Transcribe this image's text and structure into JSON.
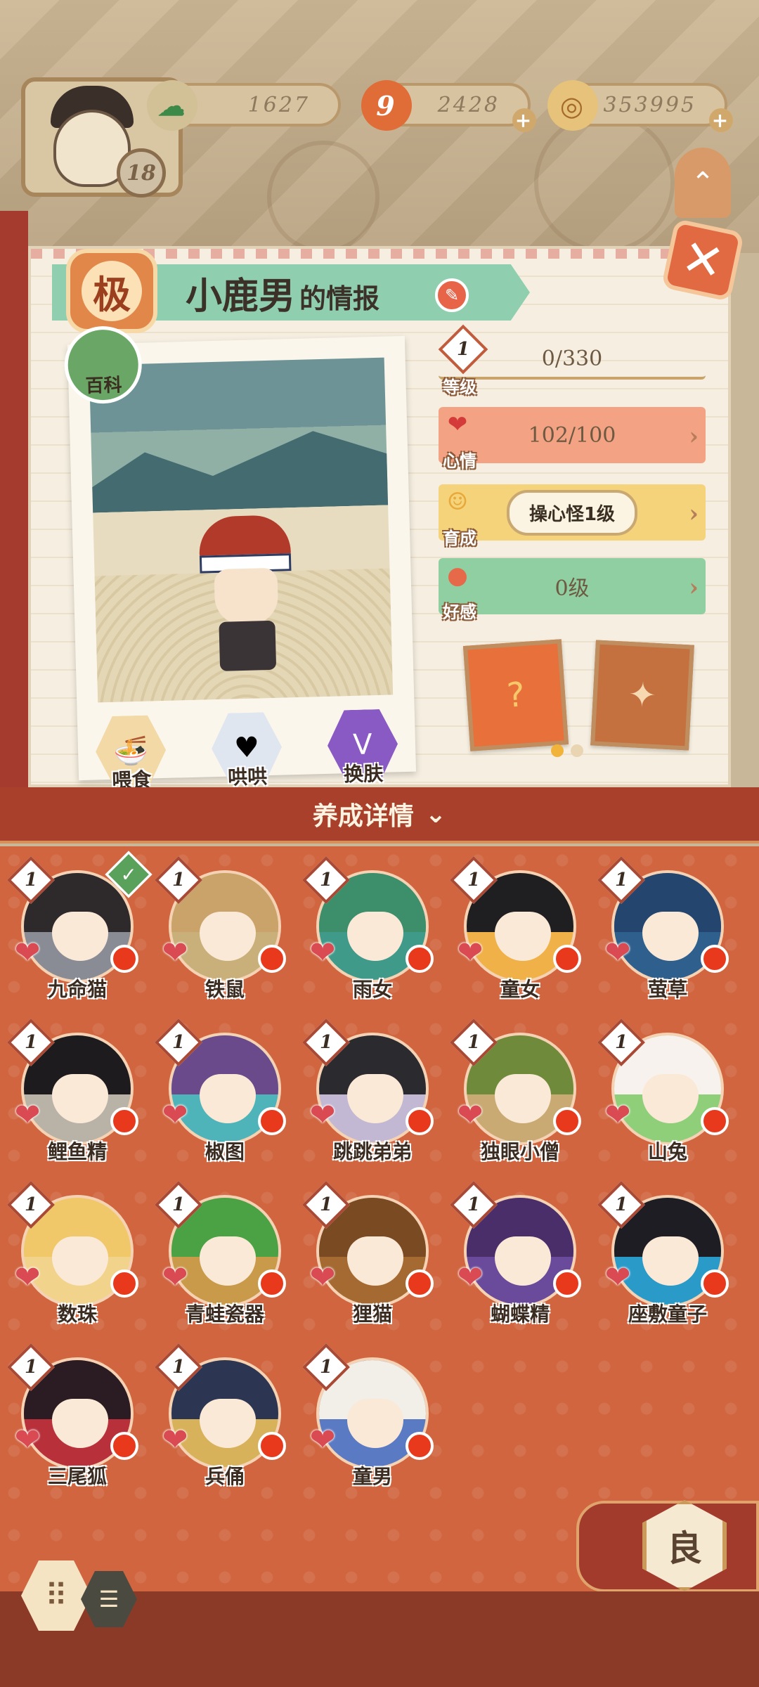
{
  "header": {
    "player_level": "18",
    "currencies": [
      {
        "name": "jade",
        "value": "1627",
        "icon": "pine-cloud-icon",
        "color": "#3d8a48"
      },
      {
        "name": "scroll",
        "value": "2428",
        "icon": "scroll-icon",
        "color": "#e06c38"
      },
      {
        "name": "coin",
        "value": "353995",
        "icon": "coin-icon",
        "color": "#d39a3a"
      }
    ]
  },
  "info": {
    "rank": "极",
    "character_name": "小鹿男",
    "title_suffix": "的情报",
    "baike_label": "百科"
  },
  "actions": [
    {
      "key": "feed",
      "label": "喂食",
      "icon": "noodle-bowl-icon",
      "color": "#f2d9a6"
    },
    {
      "key": "coax",
      "label": "哄哄",
      "icon": "milk-carton-icon",
      "color": "#dfe6f0"
    },
    {
      "key": "skin",
      "label": "换肤",
      "icon": "skin-icon",
      "color": "#8a5ac4"
    }
  ],
  "stats": {
    "level": {
      "label": "等级",
      "badge": "1",
      "value": "0/330"
    },
    "mood": {
      "label": "心情",
      "value": "102/100",
      "color": "#f3a383"
    },
    "growth": {
      "label": "育成",
      "value": "操心怪1级",
      "color": "#f4d37b"
    },
    "favor": {
      "label": "好感",
      "value": "0级",
      "color": "#8fcfa1"
    }
  },
  "details_bar": {
    "label": "养成详情"
  },
  "characters": [
    {
      "name": "九命猫",
      "level": "1",
      "hair": "#2e2a2b",
      "bg": "#8a8c95",
      "selected": true
    },
    {
      "name": "铁鼠",
      "level": "1",
      "hair": "#c9a36a",
      "bg": "#c9b07a",
      "selected": false
    },
    {
      "name": "雨女",
      "level": "1",
      "hair": "#3c8f6a",
      "bg": "#3f9a8a",
      "selected": false
    },
    {
      "name": "童女",
      "level": "1",
      "hair": "#1f1f22",
      "bg": "#f0b148",
      "selected": false
    },
    {
      "name": "萤草",
      "level": "1",
      "hair": "#24456e",
      "bg": "#2f5f8d",
      "selected": false
    },
    {
      "name": "鲤鱼精",
      "level": "1",
      "hair": "#1d1b1d",
      "bg": "#b9b2a6",
      "selected": false
    },
    {
      "name": "椒图",
      "level": "1",
      "hair": "#6a4a8a",
      "bg": "#4fb4b9",
      "selected": false
    },
    {
      "name": "跳跳弟弟",
      "level": "1",
      "hair": "#2b2a2e",
      "bg": "#c2b8d4",
      "selected": false
    },
    {
      "name": "独眼小僧",
      "level": "1",
      "hair": "#6f8a3a",
      "bg": "#c9aa72",
      "selected": false
    },
    {
      "name": "山兔",
      "level": "1",
      "hair": "#f7f2ee",
      "bg": "#8fcf7a",
      "selected": false
    },
    {
      "name": "数珠",
      "level": "1",
      "hair": "#f0c86a",
      "bg": "#f2d38c",
      "selected": false
    },
    {
      "name": "青蛙瓷器",
      "level": "1",
      "hair": "#4aa244",
      "bg": "#c99a4a",
      "selected": false
    },
    {
      "name": "狸猫",
      "level": "1",
      "hair": "#7a4a22",
      "bg": "#a46a32",
      "selected": false
    },
    {
      "name": "蝴蝶精",
      "level": "1",
      "hair": "#4a2e6a",
      "bg": "#6a4a9a",
      "selected": false
    },
    {
      "name": "座敷童子",
      "level": "1",
      "hair": "#1f1d24",
      "bg": "#2a9ac9",
      "selected": false
    },
    {
      "name": "三尾狐",
      "level": "1",
      "hair": "#2a1c22",
      "bg": "#b8303a",
      "selected": false
    },
    {
      "name": "兵俑",
      "level": "1",
      "hair": "#2c3552",
      "bg": "#d7b25a",
      "selected": false
    },
    {
      "name": "童男",
      "level": "1",
      "hair": "#f2eee8",
      "bg": "#5a7ac4",
      "selected": false
    }
  ],
  "grade_button": {
    "label": "良"
  }
}
